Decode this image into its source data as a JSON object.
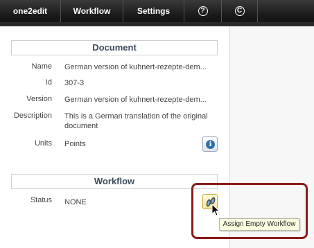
{
  "menubar": {
    "items": [
      {
        "label": "one2edit"
      },
      {
        "label": "Workflow"
      },
      {
        "label": "Settings"
      },
      {
        "icon": "help-icon",
        "glyph": "?"
      },
      {
        "icon": "copyright-icon",
        "glyph": "C"
      }
    ]
  },
  "document": {
    "title": "Document",
    "properties": {
      "name": {
        "label": "Name",
        "value": "German version of kuhnert-rezepte-dem..."
      },
      "id": {
        "label": "Id",
        "value": "307-3"
      },
      "version": {
        "label": "Version",
        "value": "German version of kuhnert-rezepte-dem..."
      },
      "description": {
        "label": "Description",
        "value": "This is a German translation of the original document"
      },
      "units": {
        "label": "Units",
        "value": "Points"
      }
    },
    "info_button_icon": "info-icon"
  },
  "workflow": {
    "title": "Workflow",
    "status": {
      "label": "Status",
      "value": "NONE"
    },
    "assign_button_icon": "footsteps-icon",
    "tooltip": "Assign Empty Workflow"
  },
  "colors": {
    "menubar_bg": "#1a1a1a",
    "highlight_border": "#8b1a1a",
    "tooltip_bg": "#ffffe1",
    "info_accent": "#2f6fae"
  }
}
